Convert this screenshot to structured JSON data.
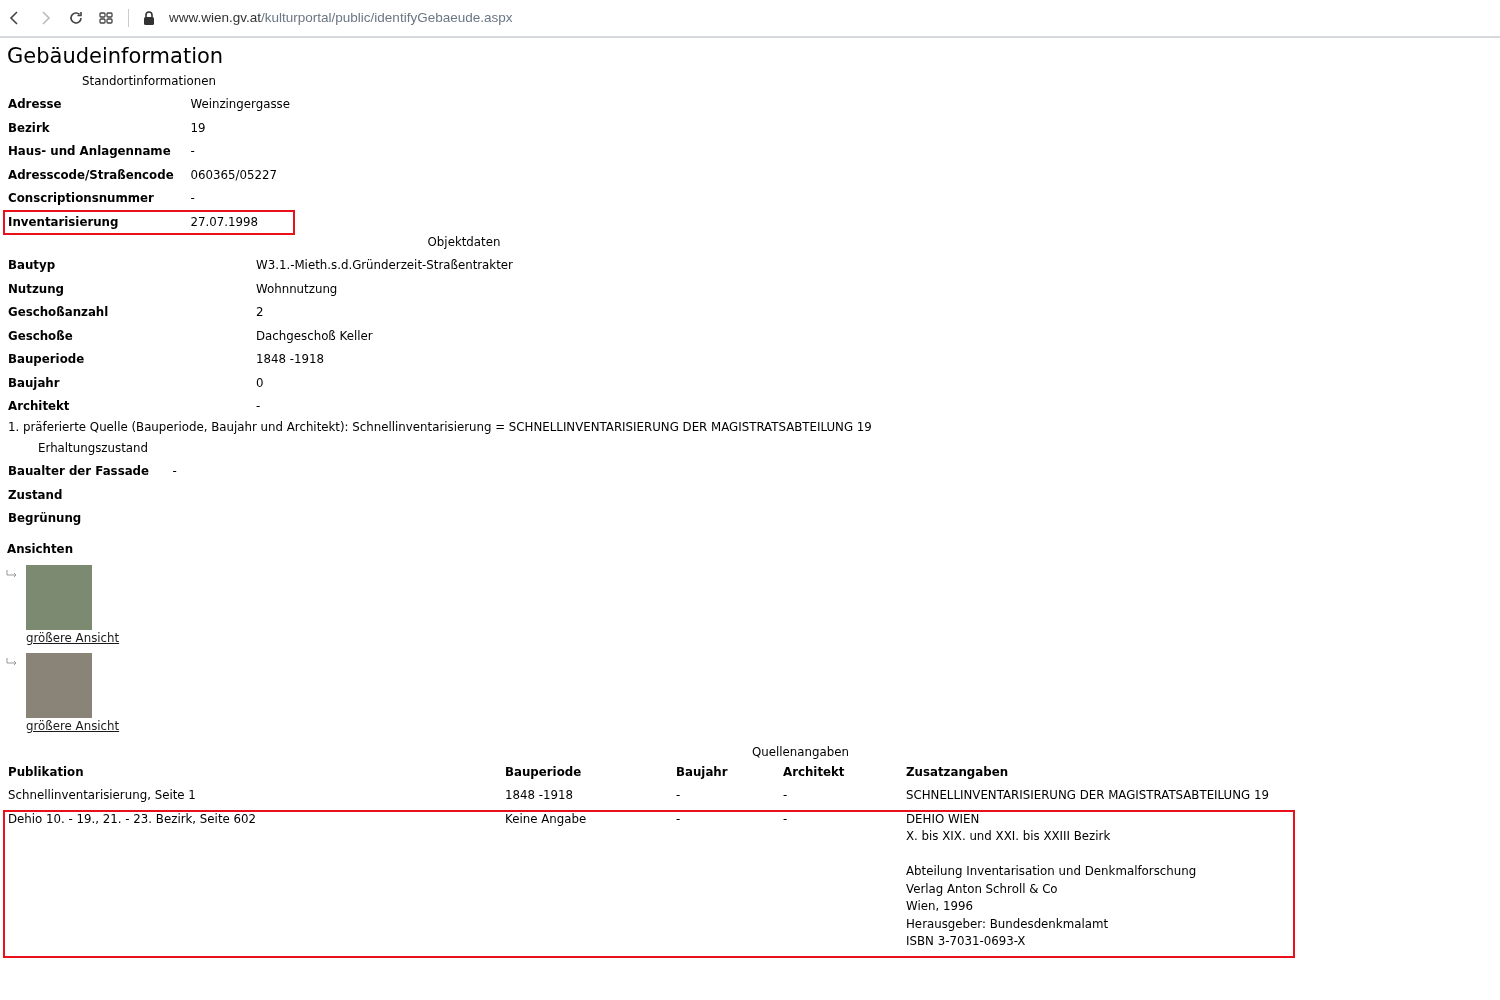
{
  "browser": {
    "url_host": "www.wien.gv.at",
    "url_path": "/kulturportal/public/identifyGebaeude.aspx"
  },
  "title": "Gebäudeinformation",
  "standort": {
    "caption": "Standortinformationen",
    "rows": [
      {
        "label": "Adresse",
        "value": "Weinzingergasse",
        "highlighted": false
      },
      {
        "label": "Bezirk",
        "value": "19",
        "highlighted": false
      },
      {
        "label": "Haus- und Anlagenname",
        "value": "-",
        "highlighted": false
      },
      {
        "label": "Adresscode/Straßencode",
        "value": "060365/05227",
        "highlighted": false
      },
      {
        "label": "Conscriptionsnummer",
        "value": "-",
        "highlighted": false
      },
      {
        "label": "Inventarisierung",
        "value": "27.07.1998",
        "highlighted": true
      }
    ]
  },
  "objekt": {
    "caption": "Objektdaten",
    "rows": [
      {
        "label": "Bautyp",
        "value": "W3.1.-Mieth.s.d.Gründerzeit-Straßentrakter"
      },
      {
        "label": "Nutzung",
        "value": "Wohnnutzung"
      },
      {
        "label": "Geschoßanzahl",
        "value": "2"
      },
      {
        "label": "Geschoße",
        "value": "Dachgeschoß Keller"
      },
      {
        "label": "Bauperiode",
        "value": "1848 -1918"
      },
      {
        "label": "Baujahr",
        "value": "0"
      },
      {
        "label": "Architekt",
        "value": "-"
      }
    ],
    "note": "1. präferierte Quelle (Bauperiode, Baujahr und Architekt): Schnellinventarisierung = SCHNELLINVENTARISIERUNG DER MAGISTRATSABTEILUNG 19"
  },
  "erhaltung": {
    "caption": "Erhaltungszustand",
    "rows": [
      {
        "label": "Baualter der Fassade",
        "value": "-"
      },
      {
        "label": "Zustand"
      },
      {
        "label": "Begrünung"
      }
    ]
  },
  "ansichten": {
    "heading": "Ansichten",
    "items": [
      {
        "link": "größere Ansicht"
      },
      {
        "link": "größere Ansicht"
      }
    ]
  },
  "quellen": {
    "caption": "Quellenangaben",
    "columns": [
      "Publikation",
      "Bauperiode",
      "Baujahr",
      "Architekt",
      "Zusatzangaben"
    ],
    "rows": [
      {
        "cells": [
          "Schnellinventarisierung, Seite 1",
          "1848 -1918",
          "-",
          "-"
        ],
        "extra": [
          [
            "SCHNELLINVENTARISIERUNG DER MAGISTRATSABTEILUNG 19"
          ]
        ],
        "highlighted": false
      },
      {
        "cells": [
          "Dehio 10. - 19., 21. - 23. Bezirk, Seite 602",
          "Keine Angabe",
          "-",
          "-"
        ],
        "extra": [
          [
            "DEHIO WIEN",
            "X. bis XIX. und XXI. bis XXIII Bezirk"
          ],
          [
            "Abteilung Inventarisation und Denkmalforschung",
            "Verlag Anton Schroll & Co",
            "Wien, 1996",
            "Herausgeber: Bundesdenkmalamt",
            "ISBN 3-7031-0693-X"
          ]
        ],
        "highlighted": true
      }
    ]
  }
}
